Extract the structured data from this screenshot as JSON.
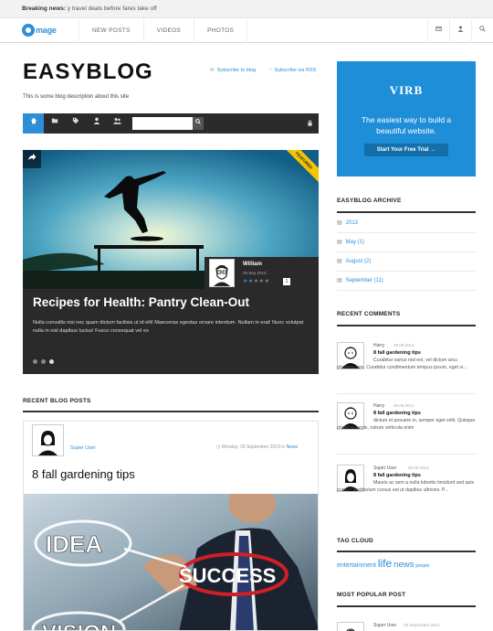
{
  "breaking": {
    "label": "Breaking news:",
    "text": "y travel deals before fares take off"
  },
  "nav": {
    "logo_text": "mage",
    "links": [
      "NEW POSTS",
      "VIDEOS",
      "PHOTOS"
    ],
    "icons": [
      "login-icon",
      "user-icon",
      "search-icon"
    ]
  },
  "blog": {
    "title": "EASYBLOG",
    "subscribe_blog": "Subscribe to blog",
    "subscribe_rss": "Subscribe via RSS",
    "description": "This is some blog description about this site"
  },
  "toolbar": {
    "icons": [
      "home-icon",
      "folder-icon",
      "tag-icon",
      "user-icon",
      "users-icon"
    ],
    "search_placeholder": "",
    "lock_icon": "lock-icon"
  },
  "featured": {
    "badge": "FEATURED",
    "author": "William",
    "date": "29 Sep 2013",
    "rating": 1,
    "stars_filled": 2,
    "stars_total": 5,
    "title": "Recipes for Health: Pantry Clean-Out",
    "excerpt": "Nulla convallis nisi nec quam dictum facilisis ut id elit! Maecenas egestas ornare interdum. Nullam in erat! Nunc volutpat nulla in nisl dapibus luctus! Fusce consequat vel ex",
    "slides": 3,
    "active_slide": 3
  },
  "recent_posts": {
    "heading": "RECENT BLOG POSTS",
    "post": {
      "author": "Super User",
      "date": "Monday, 29 September 2013",
      "date_sep": "in",
      "category": "News",
      "title": "8 fall gardening tips",
      "image_words": [
        "IDEA",
        "SUCCESS",
        "VISION"
      ]
    }
  },
  "sidebar": {
    "ad": {
      "brand": "VIRB",
      "tagline": "The easiest way to build a beautiful website.",
      "cta": "Start Your Free Trial →"
    },
    "archive": {
      "heading": "EASYBLOG ARCHIVE",
      "items": [
        {
          "label": "2013"
        },
        {
          "label": "May (1)"
        },
        {
          "label": "August (2)"
        },
        {
          "label": "September (11)"
        }
      ]
    },
    "comments": {
      "heading": "RECENT COMMENTS",
      "items": [
        {
          "name": "Harry",
          "date": "29.09.2013",
          "title": "8 fall gardening tips",
          "text": "Curabitur varius nisl est, vel dictum arcu pharetra non. Curabitur condimentum tempus ipsum, eget vi..."
        },
        {
          "name": "Harry",
          "date": "26.09.2013",
          "title": "8 fall gardening tips",
          "text": "dictum et posuere in, semper eget velit. Quisque pharetra turpis, rutrum vehicula enim"
        },
        {
          "name": "Super User",
          "date": "26.09.2013",
          "title": "8 fall gardening tips",
          "text": "Mauris ac sem a nulla lobortis tincidunt sed quis purus? Vestibulum cursus est ut dapibus ultricies. P..."
        }
      ]
    },
    "tag_cloud": {
      "heading": "TAG CLOUD",
      "tags": [
        "entertainment",
        "life",
        "news",
        "people"
      ]
    },
    "popular": {
      "heading": "MOST POPULAR POST",
      "author": "Super User",
      "date": "29 September 2013"
    }
  }
}
